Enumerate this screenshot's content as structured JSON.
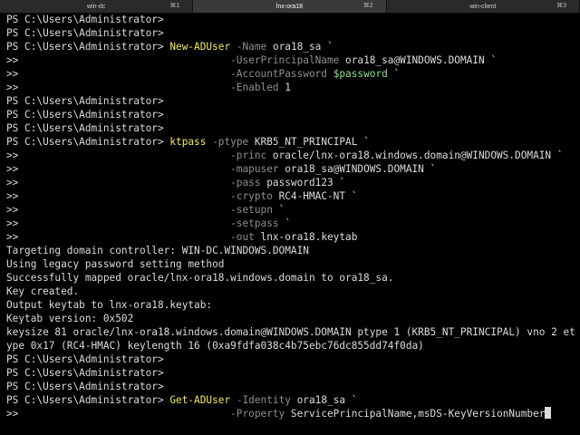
{
  "tabs": [
    {
      "title": "win-dc",
      "shortcut": "⌘1",
      "active": true
    },
    {
      "title": "lnx-ora18",
      "shortcut": "⌘2",
      "active": false
    },
    {
      "title": "win-client",
      "shortcut": "⌘3",
      "active": false
    }
  ],
  "prompt": "PS C:\\Users\\Administrator>",
  "cont": ">>",
  "lines": [
    {
      "k": "prompt"
    },
    {
      "k": "prompt"
    },
    {
      "k": "prompt",
      "segs": [
        {
          "t": "New-ADUser",
          "c": "cmd"
        },
        {
          "t": " "
        },
        {
          "t": "-Name",
          "c": "param"
        },
        {
          "t": " ora18_sa `"
        }
      ]
    },
    {
      "k": "cont",
      "segs": [
        {
          "t": "-UserPrincipalName",
          "c": "param"
        },
        {
          "t": " ora18_sa@WINDOWS.DOMAIN `"
        }
      ]
    },
    {
      "k": "cont",
      "segs": [
        {
          "t": "-AccountPassword",
          "c": "param"
        },
        {
          "t": " "
        },
        {
          "t": "$password",
          "c": "var"
        },
        {
          "t": " `"
        }
      ]
    },
    {
      "k": "cont",
      "segs": [
        {
          "t": "-Enabled",
          "c": "param"
        },
        {
          "t": " 1"
        }
      ]
    },
    {
      "k": "prompt"
    },
    {
      "k": "prompt"
    },
    {
      "k": "prompt"
    },
    {
      "k": "prompt",
      "segs": [
        {
          "t": "ktpass",
          "c": "cmd"
        },
        {
          "t": " "
        },
        {
          "t": "-ptype",
          "c": "param"
        },
        {
          "t": " KRB5_NT_PRINCIPAL `"
        }
      ]
    },
    {
      "k": "cont",
      "segs": [
        {
          "t": "-princ",
          "c": "param"
        },
        {
          "t": " oracle/lnx-ora18.windows.domain@WINDOWS.DOMAIN `"
        }
      ]
    },
    {
      "k": "cont",
      "segs": [
        {
          "t": "-mapuser",
          "c": "param"
        },
        {
          "t": " ora18_sa@WINDOWS.DOMAIN `"
        }
      ]
    },
    {
      "k": "cont",
      "segs": [
        {
          "t": "-pass",
          "c": "param"
        },
        {
          "t": " password123 `"
        }
      ]
    },
    {
      "k": "cont",
      "segs": [
        {
          "t": "-crypto",
          "c": "param"
        },
        {
          "t": " RC4-HMAC-NT `"
        }
      ]
    },
    {
      "k": "cont",
      "segs": [
        {
          "t": "-setupn",
          "c": "param"
        },
        {
          "t": " `"
        }
      ]
    },
    {
      "k": "cont",
      "segs": [
        {
          "t": "-setpass",
          "c": "param"
        },
        {
          "t": " `"
        }
      ]
    },
    {
      "k": "cont",
      "segs": [
        {
          "t": "-out",
          "c": "param"
        },
        {
          "t": " lnx-ora18.keytab"
        }
      ]
    },
    {
      "k": "out",
      "text": "Targeting domain controller: WIN-DC.WINDOWS.DOMAIN"
    },
    {
      "k": "out",
      "text": "Using legacy password setting method"
    },
    {
      "k": "out",
      "text": "Successfully mapped oracle/lnx-ora18.windows.domain to ora18_sa."
    },
    {
      "k": "out",
      "text": "Key created."
    },
    {
      "k": "out",
      "text": "Output keytab to lnx-ora18.keytab:"
    },
    {
      "k": "out",
      "text": "Keytab version: 0x502"
    },
    {
      "k": "out",
      "text": "keysize 81 oracle/lnx-ora18.windows.domain@WINDOWS.DOMAIN ptype 1 (KRB5_NT_PRINCIPAL) vno 2 et"
    },
    {
      "k": "out",
      "text": "ype 0x17 (RC4-HMAC) keylength 16 (0xa9fdfa038c4b75ebc76dc855dd74f0da)"
    },
    {
      "k": "prompt"
    },
    {
      "k": "prompt"
    },
    {
      "k": "prompt"
    },
    {
      "k": "prompt",
      "segs": [
        {
          "t": "Get-ADUser",
          "c": "cmd"
        },
        {
          "t": " "
        },
        {
          "t": "-Identity",
          "c": "param"
        },
        {
          "t": " ora18_sa `"
        }
      ]
    },
    {
      "k": "cont",
      "segs": [
        {
          "t": "-Property",
          "c": "param"
        },
        {
          "t": " ServicePrincipalName,msDS-KeyVersionNumber"
        }
      ],
      "cursor": true
    }
  ]
}
